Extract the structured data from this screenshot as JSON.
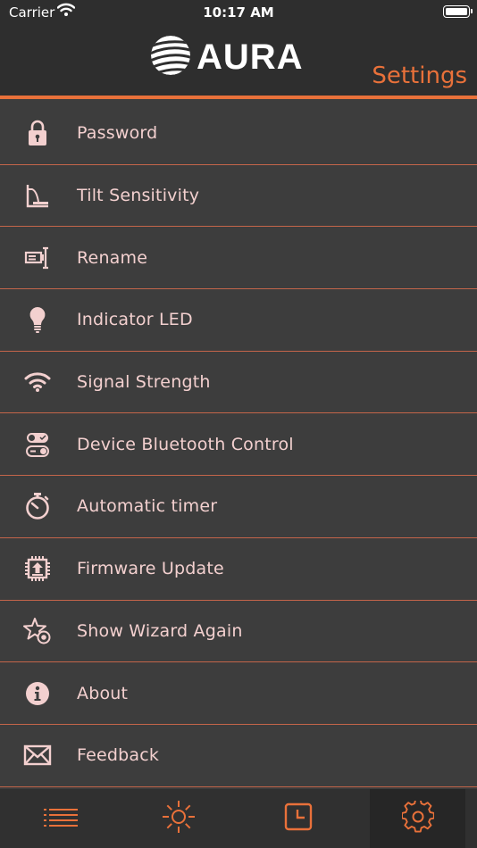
{
  "status_bar": {
    "carrier": "Carrier",
    "time": "10:17 AM"
  },
  "header": {
    "logo_text": "AURA",
    "title": "Settings"
  },
  "menu": {
    "items": [
      {
        "label": "Password",
        "icon": "lock-icon"
      },
      {
        "label": "Tilt Sensitivity",
        "icon": "tilt-icon"
      },
      {
        "label": "Rename",
        "icon": "rename-icon"
      },
      {
        "label": "Indicator LED",
        "icon": "lightbulb-icon"
      },
      {
        "label": "Signal Strength",
        "icon": "wifi-icon"
      },
      {
        "label": "Device Bluetooth Control",
        "icon": "toggle-icon"
      },
      {
        "label": "Automatic timer",
        "icon": "stopwatch-icon"
      },
      {
        "label": "Firmware Update",
        "icon": "chip-upload-icon"
      },
      {
        "label": "Show Wizard Again",
        "icon": "star-wand-icon"
      },
      {
        "label": "About",
        "icon": "info-icon"
      },
      {
        "label": "Feedback",
        "icon": "envelope-icon"
      }
    ]
  },
  "tabbar": {
    "tabs": [
      {
        "icon": "list-icon"
      },
      {
        "icon": "sun-icon"
      },
      {
        "icon": "clock-icon"
      },
      {
        "icon": "gear-icon",
        "active": true
      }
    ]
  },
  "colors": {
    "accent": "#e9713a",
    "text": "#f3d0cf",
    "background": "#3d3d3d",
    "header": "#2e2e2e",
    "divider": "#c4654a"
  }
}
